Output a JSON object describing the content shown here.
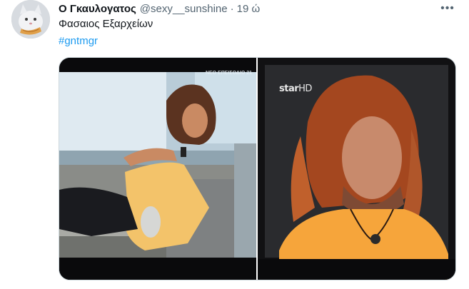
{
  "tweet": {
    "author_name": "Ο Γκαυλογατος",
    "handle": "@sexy__sunshine",
    "separator": "·",
    "time": "19 ώ",
    "more_icon": "more-horizontal-icon",
    "text": "Φασαιος Εξαρχείων",
    "hashtag": "#gntmgr"
  },
  "media": {
    "left_overlay": "ΝΕΟ ΕΠΕΙΣΟΔΙΟ 21",
    "right_logo_main": "star",
    "right_logo_hd": "HD"
  },
  "colors": {
    "link": "#1d9bf0",
    "secondary_text": "#536471",
    "border": "#cfd9de"
  }
}
